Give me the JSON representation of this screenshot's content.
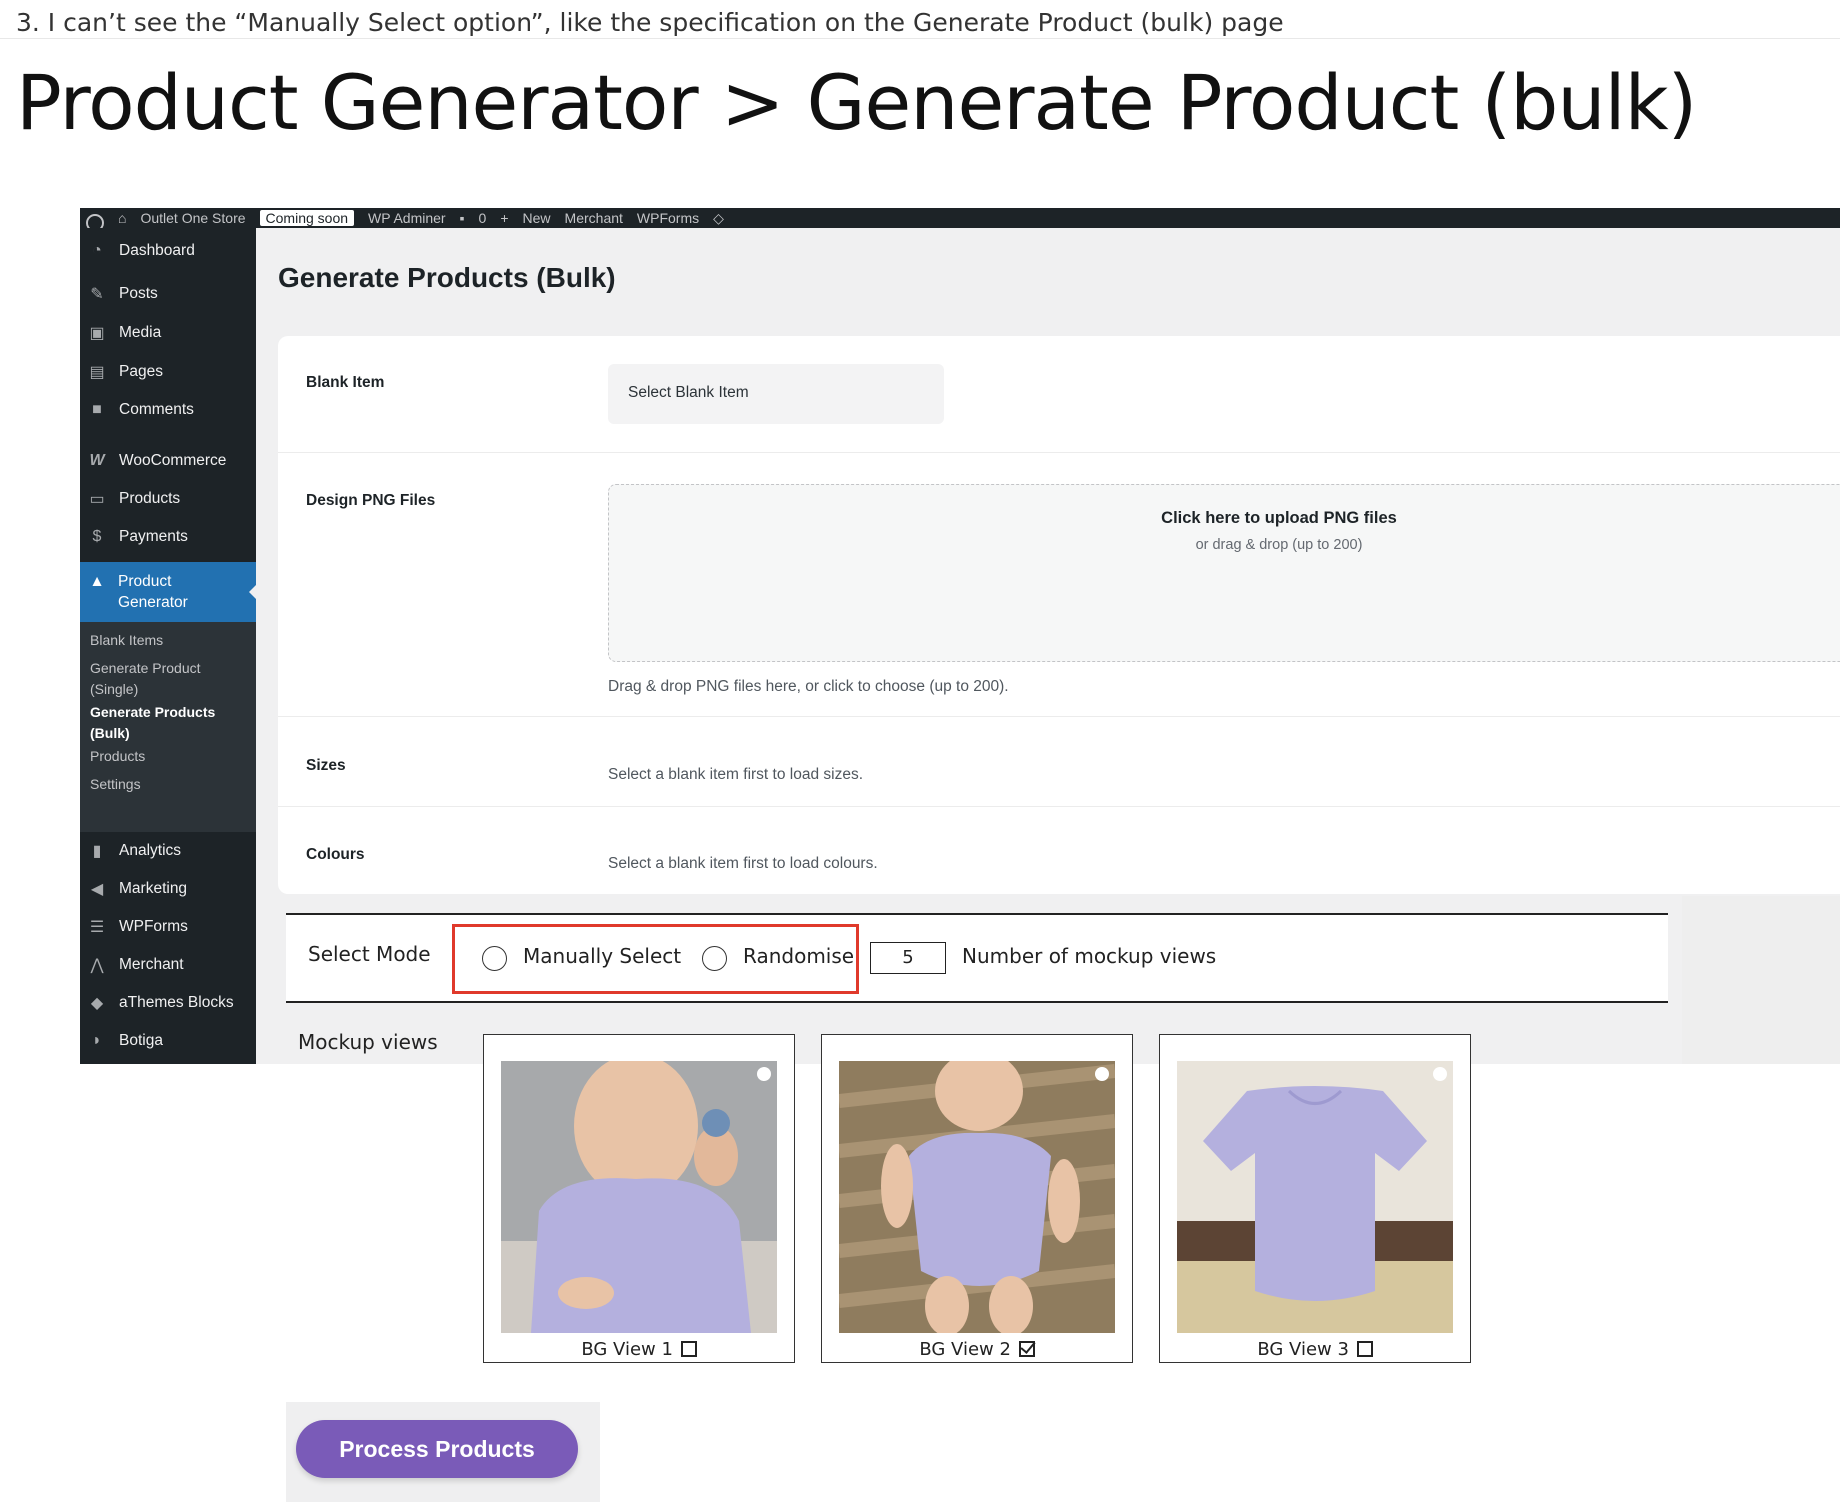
{
  "note": "3. I can’t see the “Manually Select option”, like the specification on the Generate Product (bulk) page",
  "doc_title": "Product Generator > Generate Product (bulk)",
  "admin_bar": {
    "site": "Outlet One Store",
    "badge": "Coming soon",
    "items": [
      "WP Adminer",
      "0",
      "New",
      "Merchant",
      "WPForms"
    ]
  },
  "sidebar": {
    "items": [
      {
        "label": "Dashboard",
        "icon": "dashboard-icon"
      },
      {
        "label": "Posts",
        "icon": "pin-icon"
      },
      {
        "label": "Media",
        "icon": "media-icon"
      },
      {
        "label": "Pages",
        "icon": "pages-icon"
      },
      {
        "label": "Comments",
        "icon": "comment-icon"
      },
      {
        "label": "WooCommerce",
        "icon": "woo-icon"
      },
      {
        "label": "Products",
        "icon": "archive-icon"
      },
      {
        "label": "Payments",
        "icon": "dollar-icon"
      }
    ],
    "active": {
      "label_line1": "Product",
      "label_line2": "Generator"
    },
    "submenu": [
      {
        "line1": "Blank Items",
        "line2": ""
      },
      {
        "line1": "Generate Product",
        "line2": "(Single)"
      },
      {
        "line1": "Generate Products",
        "line2": "(Bulk)"
      },
      {
        "line1": "Products",
        "line2": ""
      },
      {
        "line1": "Settings",
        "line2": ""
      }
    ],
    "items_after": [
      {
        "label": "Analytics",
        "icon": "analytics-icon"
      },
      {
        "label": "Marketing",
        "icon": "megaphone-icon"
      },
      {
        "label": "WPForms",
        "icon": "forms-icon"
      },
      {
        "label": "Merchant",
        "icon": "merchant-icon"
      },
      {
        "label": "aThemes Blocks",
        "icon": "blocks-icon"
      },
      {
        "label": "Botiga",
        "icon": "botiga-icon"
      }
    ]
  },
  "page": {
    "heading": "Generate Products (Bulk)",
    "blank_item": {
      "label": "Blank Item",
      "select": "Select Blank Item"
    },
    "design": {
      "label": "Design PNG Files",
      "drop_main": "Click here to upload PNG files",
      "drop_sub": "or drag & drop (up to 200)",
      "hint": "Drag & drop PNG files here, or click to choose (up to 200)."
    },
    "sizes": {
      "label": "Sizes",
      "hint": "Select a blank item first to load sizes."
    },
    "colours": {
      "label": "Colours",
      "hint": "Select a blank item first to load colours."
    }
  },
  "mockup": {
    "select_mode_label": "Select Mode",
    "manual_label": "Manually Select",
    "randomise_label": "Randomise",
    "num_value": "5",
    "num_label": "Number of mockup views",
    "views_label": "Mockup views",
    "views": [
      {
        "caption": "BG View 1",
        "checked": false
      },
      {
        "caption": "BG View 2",
        "checked": true
      },
      {
        "caption": "BG View 3",
        "checked": false
      }
    ],
    "process_label": "Process Products",
    "colors": {
      "garment": "#b4b0de",
      "button": "#7a5bb8",
      "highlight": "#e0392b"
    }
  }
}
